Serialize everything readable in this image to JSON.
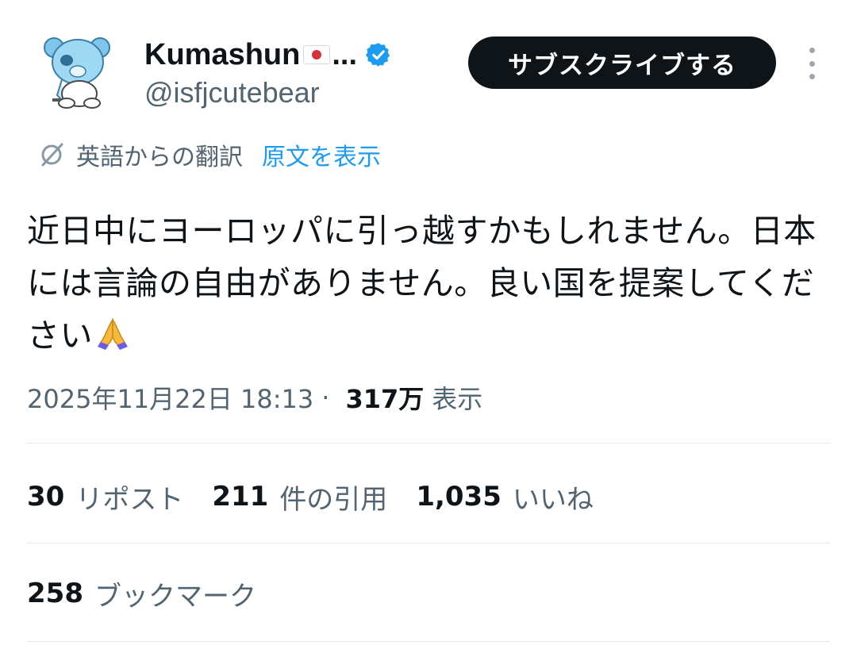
{
  "author": {
    "display_name": "Kumashun",
    "name_suffix": "...",
    "flag_icon": "japan-flag-icon",
    "verified_icon": "verified-badge-icon",
    "handle": "@isfjcutebear",
    "avatar_icon": "bear-avatar-icon"
  },
  "header": {
    "subscribe_label": "サブスクライブする",
    "more_icon": "more-options-icon"
  },
  "translation": {
    "icon": "translate-icon",
    "label": "英語からの翻訳",
    "show_original": "原文を表示"
  },
  "tweet": {
    "text": "近日中にヨーロッパに引っ越すかもしれません。日本には言論の自由がありません。良い国を提案してください",
    "emoji_icon": "folded-hands-emoji"
  },
  "meta": {
    "timestamp": "2025年11月22日 18:13",
    "separator": "·",
    "views_count": "317万",
    "views_label": "表示"
  },
  "stats": {
    "reposts": {
      "count": "30",
      "label": "リポスト"
    },
    "quotes": {
      "count": "211",
      "label": "件の引用"
    },
    "likes": {
      "count": "1,035",
      "label": "いいね"
    },
    "bookmarks": {
      "count": "258",
      "label": "ブックマーク"
    }
  },
  "colors": {
    "accent": "#1d9bf0",
    "text_primary": "#0f1419",
    "text_secondary": "#536471",
    "button_bg": "#0f1419"
  }
}
